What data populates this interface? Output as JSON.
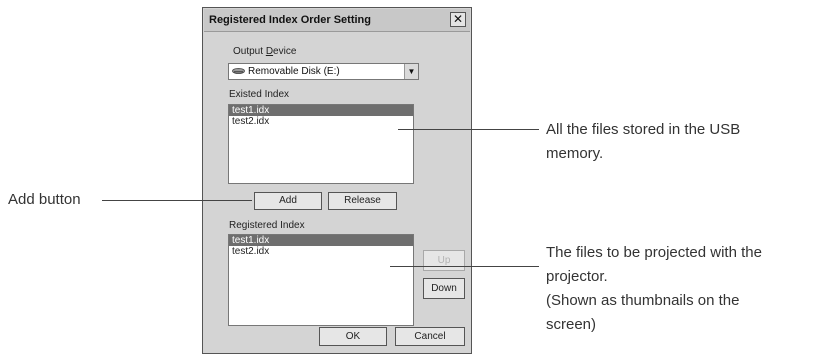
{
  "dialog": {
    "title": "Registered Index Order Setting",
    "close_symbol": "✕",
    "output_device_label_prefix": "Output ",
    "output_device_label_mnemonic": "D",
    "output_device_label_suffix": "evice",
    "output_device_value": "Removable Disk (E:)",
    "output_device_icon": "drive-icon",
    "dropdown_symbol": "▼",
    "existed_index_label": "Existed Index",
    "existed_index_items": [
      "test1.idx",
      "test2.idx"
    ],
    "existed_selected_index": 0,
    "add_label": "Add",
    "release_label": "Release",
    "registered_index_label": "Registered Index",
    "registered_index_items": [
      "test1.idx",
      "test2.idx"
    ],
    "registered_selected_index": 0,
    "up_label": "Up",
    "down_label": "Down",
    "ok_label": "OK",
    "cancel_label": "Cancel"
  },
  "annotations": {
    "add_button": "Add button",
    "existed_files_line1": "All the files stored in the USB",
    "existed_files_line2": "memory.",
    "registered_line1": "The files to be projected with the",
    "registered_line2": "projector.",
    "registered_line3": "(Shown as thumbnails on the",
    "registered_line4": "screen)"
  },
  "colors": {
    "selection": "#6e6e6e",
    "dialog_bg": "#d4d4d4"
  }
}
